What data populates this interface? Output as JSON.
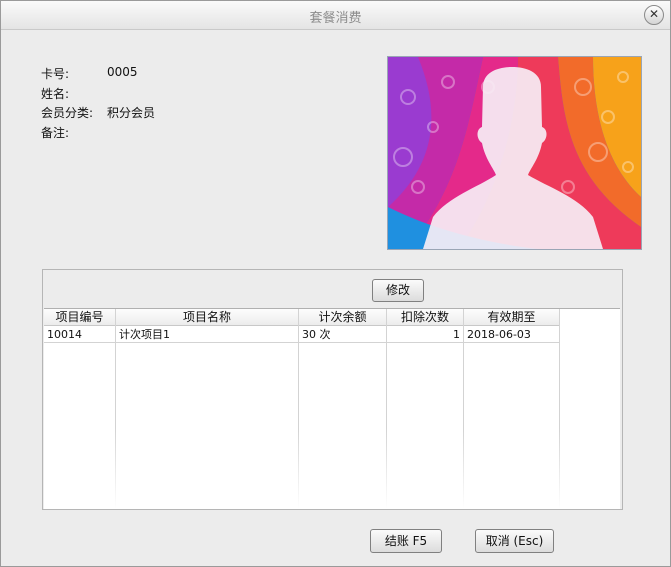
{
  "window": {
    "title": "套餐消费"
  },
  "member": {
    "card_label": "卡号:",
    "card_value": "0005",
    "name_label": "姓名:",
    "name_value": "",
    "category_label": "会员分类:",
    "category_value": "积分会员",
    "note_label": "备注:",
    "note_value": ""
  },
  "buttons": {
    "edit": "修改",
    "checkout": "结账 F5",
    "cancel": "取消 (Esc)"
  },
  "table": {
    "columns": [
      "项目编号",
      "项目名称",
      "计次余额",
      "扣除次数",
      "有效期至"
    ],
    "rows": [
      {
        "code": "10014",
        "name": "计次项目1",
        "balance": "30 次",
        "deduct": "1",
        "expiry": "2018-06-03"
      }
    ]
  },
  "colors": {
    "background": "#ececec",
    "title_text": "#8c8c8c",
    "grid_line": "#d3d3d3"
  },
  "icons": {
    "close": "close-icon",
    "avatar": "user-silhouette-icon"
  }
}
